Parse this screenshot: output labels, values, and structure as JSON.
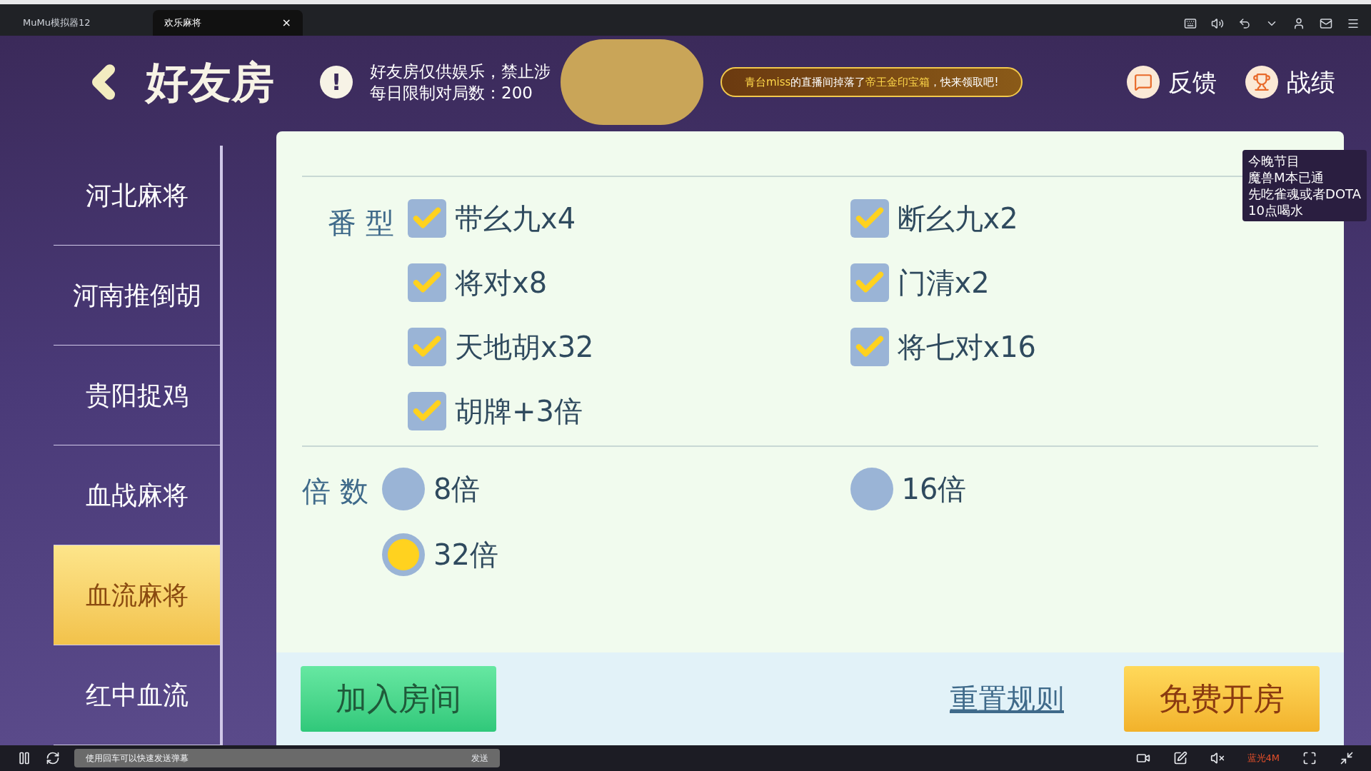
{
  "browser": {
    "tabs": [
      {
        "label": "MuMu模拟器12",
        "selected": false
      },
      {
        "label": "欢乐麻将",
        "selected": true,
        "close": "×"
      }
    ]
  },
  "header": {
    "title": "好友房",
    "alert": "!",
    "notice_lines": [
      "好友房仅供娱乐，禁止涉",
      "每日限制对局数：200"
    ],
    "banner": [
      "青台miss",
      "的直播间掉落了",
      "帝王金印宝箱",
      "，快来领取吧!"
    ],
    "actions": [
      "反馈",
      "战绩"
    ]
  },
  "overlay_note": [
    "今晚节目",
    "魔兽M本已通",
    "先吃雀魂或者DOTA",
    "10点喝水"
  ],
  "sidebar": {
    "items": [
      {
        "label": "河北麻将",
        "selected": false
      },
      {
        "label": "河南推倒胡",
        "selected": false
      },
      {
        "label": "贵阳捉鸡",
        "selected": false
      },
      {
        "label": "血战麻将",
        "selected": false
      },
      {
        "label": "血流麻将",
        "selected": true
      },
      {
        "label": "红中血流",
        "selected": false
      }
    ]
  },
  "fan_types": {
    "label": "番 型",
    "options": [
      {
        "label": "带幺九x4",
        "checked": true
      },
      {
        "label": "断幺九x2",
        "checked": true
      },
      {
        "label": "将对x8",
        "checked": true
      },
      {
        "label": "门清x2",
        "checked": true
      },
      {
        "label": "天地胡x32",
        "checked": true
      },
      {
        "label": "将七对x16",
        "checked": true
      },
      {
        "label": "胡牌+3倍",
        "checked": true
      }
    ]
  },
  "multiplier": {
    "label": "倍 数",
    "options": [
      {
        "label": "8倍",
        "selected": false
      },
      {
        "label": "16倍",
        "selected": false
      },
      {
        "label": "32倍",
        "selected": true
      }
    ]
  },
  "footer": {
    "join": "加入房间",
    "reset": "重置规则",
    "create": "免费开房"
  },
  "player_bar": {
    "danmaku_placeholder": "使用回车可以快速发送弹幕",
    "send": "发送",
    "quality": "蓝光4M"
  }
}
